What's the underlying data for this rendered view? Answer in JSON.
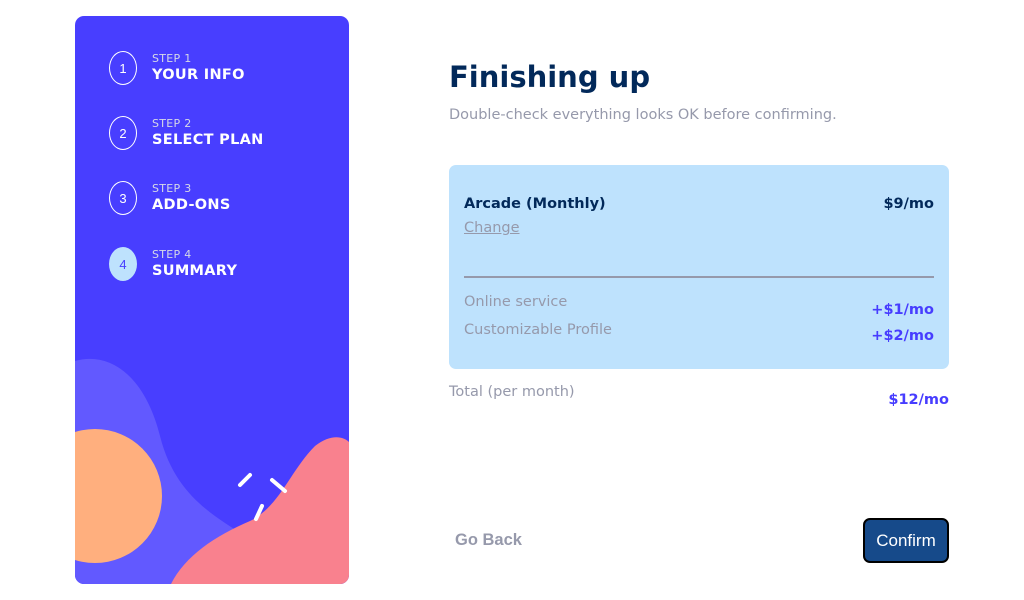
{
  "sidebar": {
    "steps": [
      {
        "number": "1",
        "label": "STEP 1",
        "title": "YOUR INFO",
        "active": false
      },
      {
        "number": "2",
        "label": "STEP 2",
        "title": "SELECT PLAN",
        "active": false
      },
      {
        "number": "3",
        "label": "STEP 3",
        "title": "ADD-ONS",
        "active": false
      },
      {
        "number": "4",
        "label": "STEP 4",
        "title": "SUMMARY",
        "active": true
      }
    ]
  },
  "main": {
    "title": "Finishing up",
    "subtitle": "Double-check everything looks OK before confirming.",
    "plan": {
      "name": "Arcade (Monthly)",
      "price": "$9/mo",
      "change_label": "Change"
    },
    "addons": [
      {
        "name": "Online service",
        "price": "+$1/mo"
      },
      {
        "name": "Customizable Profile",
        "price": "+$2/mo"
      }
    ],
    "total": {
      "label": "Total (per month)",
      "price": "$12/mo"
    }
  },
  "buttons": {
    "back": "Go Back",
    "confirm": "Confirm"
  },
  "colors": {
    "sidebar_bg": "#483eff",
    "active_step": "#bee2fd",
    "heading": "#02295a",
    "muted": "#9699ab",
    "accent": "#473dff",
    "summary_bg": "#bee2fd",
    "confirm_bg": "#164a8a"
  }
}
